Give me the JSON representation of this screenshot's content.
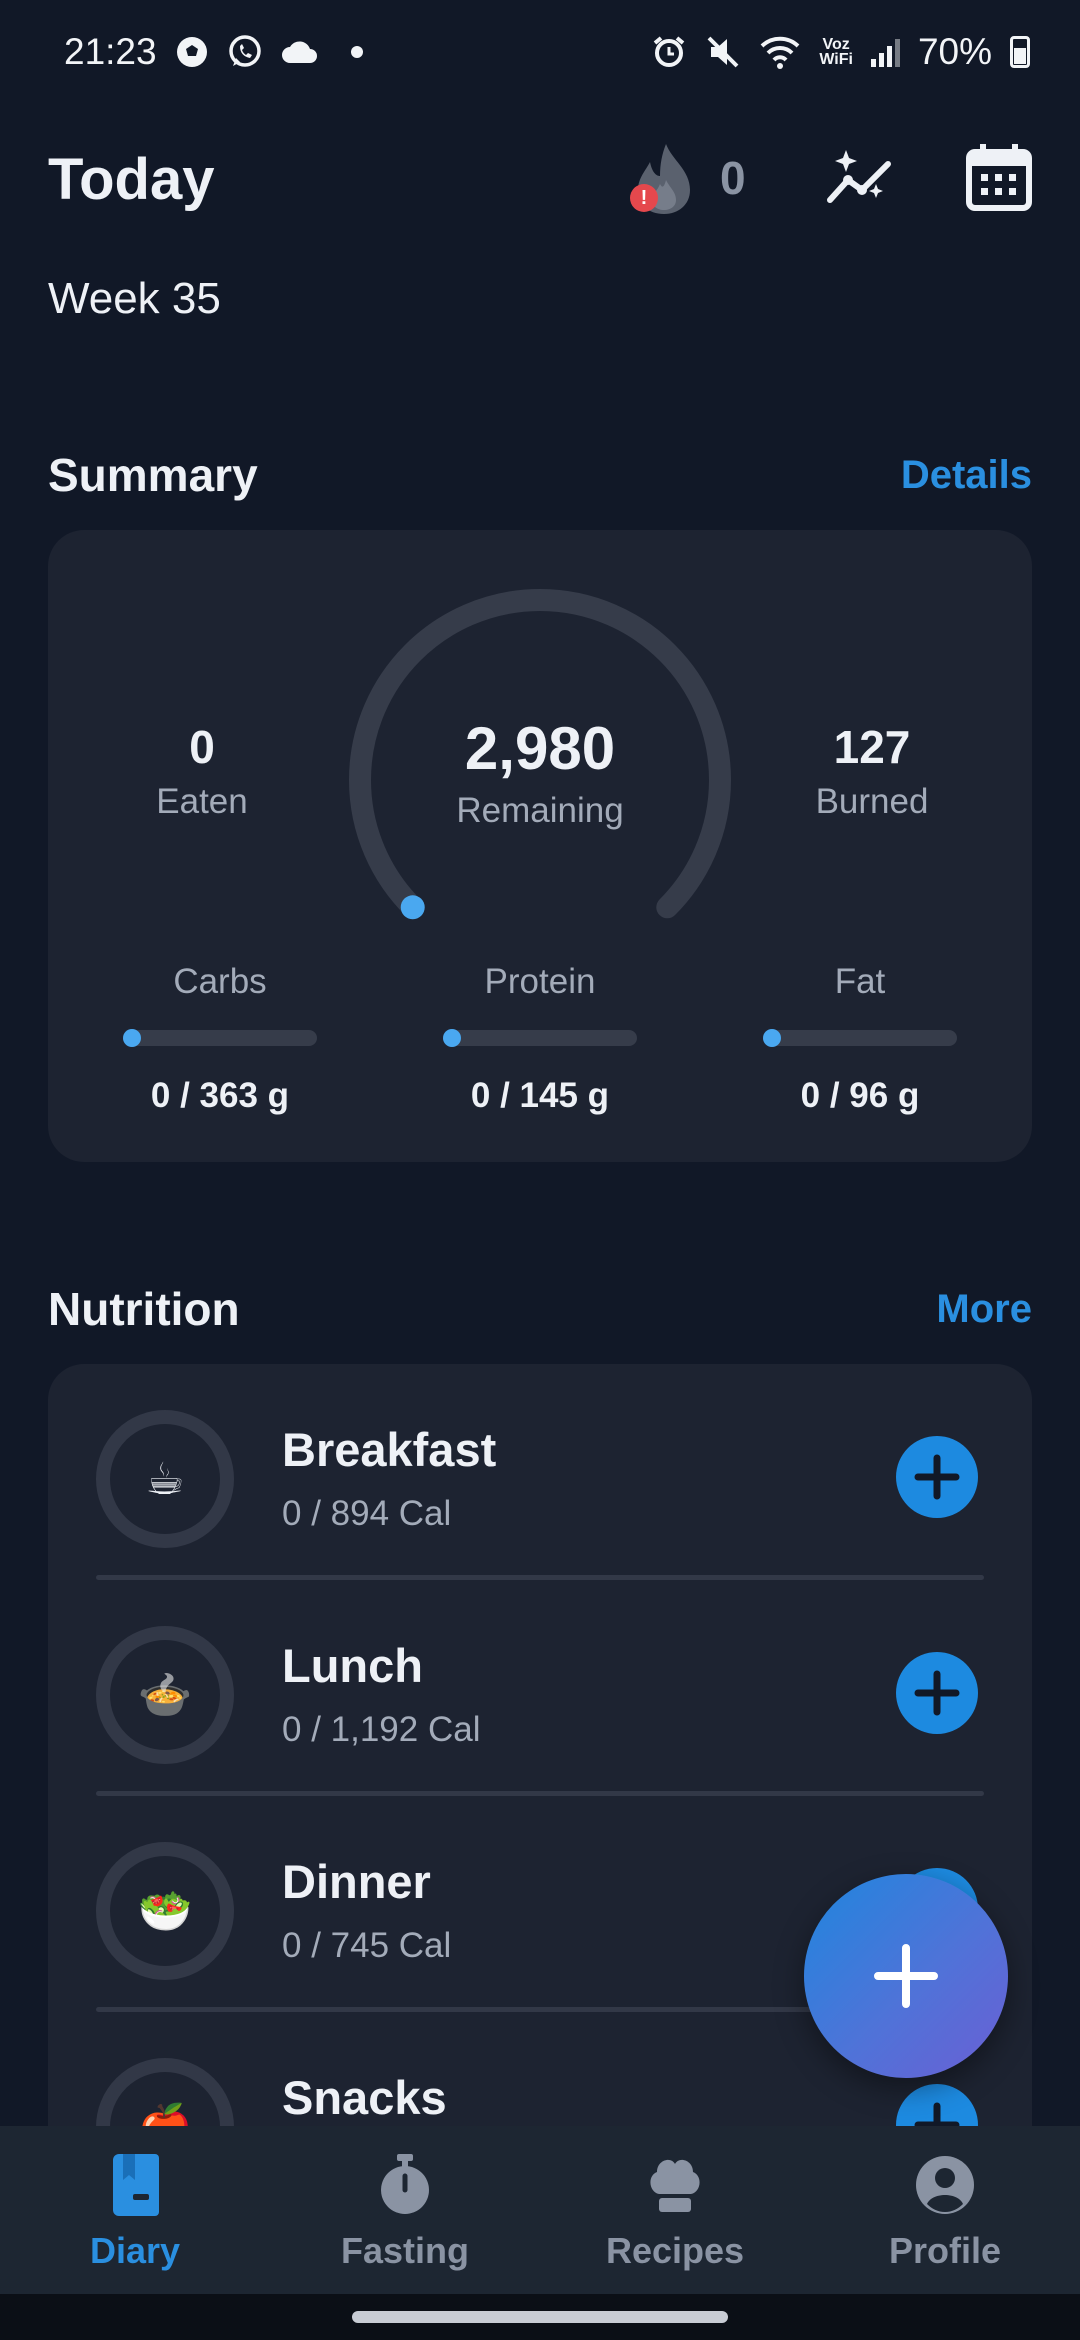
{
  "status_bar": {
    "time": "21:23",
    "left_icons": [
      "soccer-ball-icon",
      "whatsapp-icon",
      "cloud-icon",
      "dot-icon"
    ],
    "right_icons": [
      "alarm-icon",
      "mute-icon",
      "wifi-icon",
      "voz-wifi-icon",
      "signal-icon",
      "battery-icon"
    ],
    "voz_wifi_top": "Voz",
    "voz_wifi_bottom": "WiFi",
    "battery": "70%"
  },
  "header": {
    "title": "Today",
    "streak_count": "0",
    "week": "Week 35"
  },
  "summary": {
    "title": "Summary",
    "details_link": "Details",
    "eaten_value": "0",
    "eaten_label": "Eaten",
    "remaining_value": "2,980",
    "remaining_label": "Remaining",
    "burned_value": "127",
    "burned_label": "Burned",
    "remaining_progress": 0,
    "macros": [
      {
        "label": "Carbs",
        "value": "0 / 363 g",
        "progress": 0
      },
      {
        "label": "Protein",
        "value": "0 / 145 g",
        "progress": 0
      },
      {
        "label": "Fat",
        "value": "0 / 96 g",
        "progress": 0
      }
    ]
  },
  "nutrition": {
    "title": "Nutrition",
    "more_link": "More",
    "meals": [
      {
        "name": "Breakfast",
        "calories": "0 / 894 Cal",
        "emoji": "☕"
      },
      {
        "name": "Lunch",
        "calories": "0 / 1,192 Cal",
        "emoji": "🍲"
      },
      {
        "name": "Dinner",
        "calories": "0 / 745 Cal",
        "emoji": "🥗"
      },
      {
        "name": "Snacks",
        "calories": "",
        "emoji": "🍎"
      }
    ]
  },
  "nav": {
    "items": [
      {
        "label": "Diary",
        "icon": "diary-icon",
        "active": true
      },
      {
        "label": "Fasting",
        "icon": "stopwatch-icon",
        "active": false
      },
      {
        "label": "Recipes",
        "icon": "chef-hat-icon",
        "active": false
      },
      {
        "label": "Profile",
        "icon": "profile-icon",
        "active": false
      }
    ]
  },
  "colors": {
    "background": "#111827",
    "card": "#1d2331",
    "accent": "#2a8fe0",
    "progress_dot": "#4aa8f0"
  }
}
